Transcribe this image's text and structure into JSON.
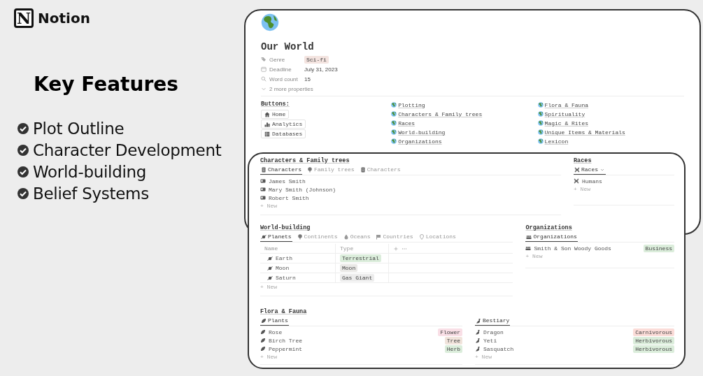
{
  "brand": {
    "logo_letter": "N",
    "name": "Notion"
  },
  "heading": "Key Features",
  "features": [
    {
      "label": "Plot Outline",
      "checked": true
    },
    {
      "label": "Character Development",
      "checked": true
    },
    {
      "label": "World-building",
      "checked": true
    },
    {
      "label": "Belief Systems",
      "checked": true
    }
  ],
  "back_page": {
    "title": "Our World",
    "properties": [
      {
        "kind": "tag",
        "label": "Genre",
        "value": "Sci-fi"
      },
      {
        "kind": "date",
        "label": "Deadline",
        "value": "July 31, 2023"
      },
      {
        "kind": "count",
        "label": "Word count",
        "value": "15"
      }
    ],
    "more_properties": "2 more properties",
    "buttons_label": "Buttons:",
    "buttons": [
      {
        "kind": "home",
        "label": "Home"
      },
      {
        "kind": "chart",
        "label": "Analytics"
      },
      {
        "kind": "table",
        "label": "Databases"
      }
    ],
    "links_left": [
      "Plotting",
      "Characters & Family trees",
      "Races",
      "World-building",
      "Organizations"
    ],
    "links_right": [
      "Flora & Fauna",
      "Spirituality",
      "Magic & Rites",
      "Unique Items & Materials",
      "Lexicon"
    ]
  },
  "front_page": {
    "characters": {
      "title": "Characters & Family trees",
      "tabs": [
        {
          "label": "Characters",
          "selected": true
        },
        {
          "label": "Family trees",
          "selected": false
        },
        {
          "label": "Characters",
          "selected": false
        }
      ],
      "rows": [
        "James Smith",
        "Mary Smith (Johnson)",
        "Robert Smith"
      ],
      "new": "+ New"
    },
    "races": {
      "title": "Races",
      "tabs": [
        {
          "label": "Races",
          "selected": true
        }
      ],
      "rows": [
        "Humans"
      ],
      "new": "+ New"
    },
    "world_building": {
      "title": "World-building",
      "tabs": [
        {
          "label": "Planets",
          "selected": true
        },
        {
          "label": "Continents",
          "selected": false
        },
        {
          "label": "Oceans",
          "selected": false
        },
        {
          "label": "Countries",
          "selected": false
        },
        {
          "label": "Locations",
          "selected": false
        }
      ],
      "columns": [
        "Name",
        "Type"
      ],
      "rows": [
        {
          "name": "Earth",
          "type": "Terrestrial",
          "color": "#dbeddb"
        },
        {
          "name": "Moon",
          "type": "Moon",
          "color": "#e9e8e6"
        },
        {
          "name": "Saturn",
          "type": "Gas Giant",
          "color": "#ececec"
        }
      ],
      "new": "+ New"
    },
    "organizations": {
      "title": "Organizations",
      "tabs": [
        {
          "label": "Organizations",
          "selected": true
        }
      ],
      "rows": [
        {
          "name": "Smith & Son Woody Goods",
          "tag": "Business",
          "color": "#dbeddb"
        }
      ],
      "new": "+ New"
    },
    "flora": {
      "title": "Flora & Fauna",
      "tabs": [
        {
          "label": "Plants",
          "selected": true
        }
      ],
      "rows": [
        {
          "name": "Rose",
          "tag": "Flower",
          "color": "#f9dfe6"
        },
        {
          "name": "Birch Tree",
          "tag": "Tree",
          "color": "#f1e4dc"
        },
        {
          "name": "Peppermint",
          "tag": "Herb",
          "color": "#dbeddb"
        }
      ],
      "new": "+ New"
    },
    "bestiary": {
      "tabs": [
        {
          "label": "Bestiary",
          "selected": true
        }
      ],
      "rows": [
        {
          "name": "Dragon",
          "tag": "Carnivorous",
          "color": "#fbdcd8"
        },
        {
          "name": "Yeti",
          "tag": "Herbivorous",
          "color": "#dbeddb"
        },
        {
          "name": "Sasquatch",
          "tag": "Herbivorous",
          "color": "#dbeddb"
        }
      ],
      "new": "+ New"
    }
  }
}
